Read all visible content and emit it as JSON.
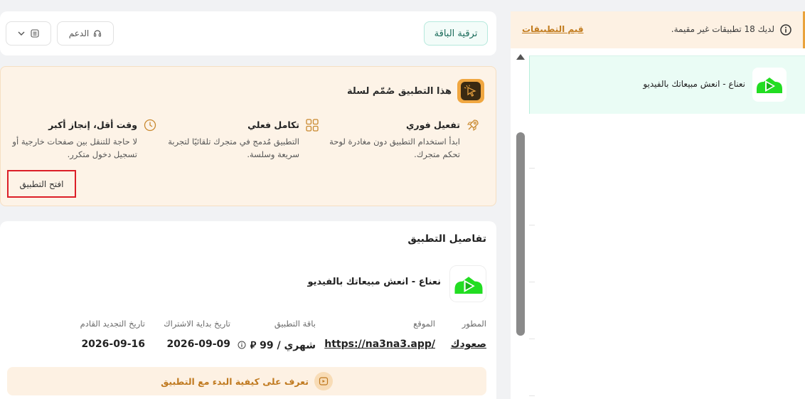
{
  "colors": {
    "accent_orange": "#e9a23b",
    "app_green": "#22dd22",
    "teal_border": "#b6e9dd",
    "highlight_red": "#dc1e28"
  },
  "sidebar": {
    "notice_text": "لديك 18 تطبيقات غير مقيمة.",
    "rate_link": "قيم التطبيقات",
    "app_item_name": "نعناع - انعش مبيعاتك بالفيديو"
  },
  "topbar": {
    "upgrade_label": "ترقية الباقة",
    "support_label": "الدعم",
    "support_icon": "headset-icon",
    "menu_icon": "list-icon"
  },
  "promo": {
    "title": "هذا التطبيق صُمّم لسلة",
    "features": [
      {
        "icon": "rocket-icon",
        "title": "تفعيل فوري",
        "desc": "ابدأ استخدام التطبيق دون مغادرة لوحة تحكم متجرك."
      },
      {
        "icon": "grid-icon",
        "title": "تكامل فعلي",
        "desc": "التطبيق مُدمج في متجرك تلقائيًا لتجربة سريعة وسلسة."
      },
      {
        "icon": "clock-icon",
        "title": "وقت أقل، إنجاز أكبر",
        "desc": "لا حاجة للتنقل بين صفحات خارجية أو تسجيل دخول متكرر."
      }
    ],
    "open_app_label": "افتح التطبيق"
  },
  "details": {
    "title": "تفاصيل التطبيق",
    "app_name": "نعناع - انعش مبيعاتك بالفيديو",
    "fields": {
      "developer": {
        "label": "المطور",
        "value": "صعودك"
      },
      "website": {
        "label": "الموقع",
        "value": "https://na3na3.app/"
      },
      "plan": {
        "label": "باقة التطبيق",
        "value": "شهري / 99 ⃁"
      },
      "start_date": {
        "label": "تاريخ بداية الاشتراك",
        "value": "2026-09-09"
      },
      "renewal_date": {
        "label": "تاريخ التجديد القادم",
        "value": "2026-09-16"
      }
    },
    "learn_text": "تعرف على كيفية البدء مع التطبيق"
  }
}
